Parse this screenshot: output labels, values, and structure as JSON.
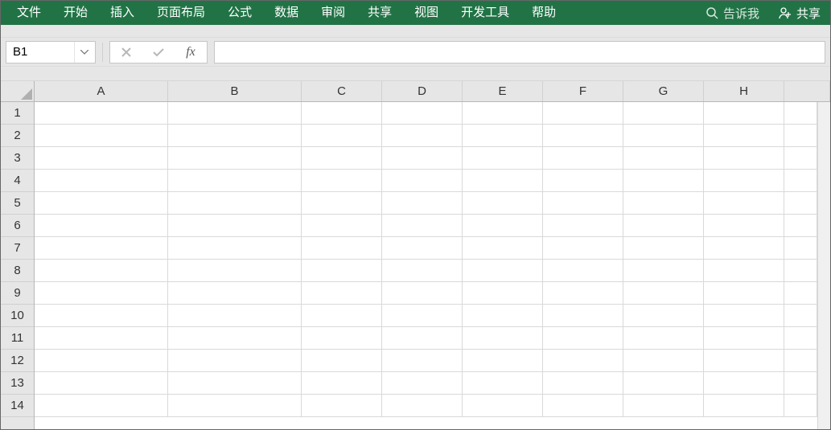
{
  "ribbon": {
    "tabs": [
      "文件",
      "开始",
      "插入",
      "页面布局",
      "公式",
      "数据",
      "审阅",
      "共享",
      "视图",
      "开发工具",
      "帮助"
    ],
    "tell_me": "告诉我",
    "share": "共享"
  },
  "formula_bar": {
    "name_box_value": "B1",
    "cancel": "✕",
    "enter": "✓",
    "fx": "fx",
    "formula_value": ""
  },
  "grid": {
    "columns": [
      "A",
      "B",
      "C",
      "D",
      "E",
      "F",
      "G",
      "H"
    ],
    "rows": [
      "1",
      "2",
      "3",
      "4",
      "5",
      "6",
      "7",
      "8",
      "9",
      "10",
      "11",
      "12",
      "13",
      "14"
    ],
    "cells": {}
  }
}
